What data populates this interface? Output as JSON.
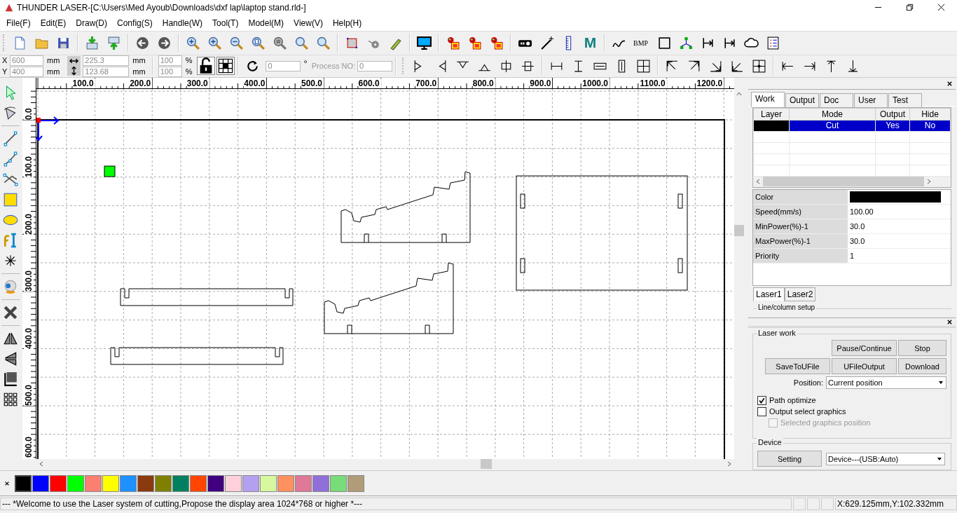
{
  "window": {
    "title": "THUNDER LASER-[C:\\Users\\Med Ayoub\\Downloads\\dxf lap\\laptop stand.rld-]"
  },
  "menu": [
    "File(F)",
    "Edit(E)",
    "Draw(D)",
    "Config(S)",
    "Handle(W)",
    "Tool(T)",
    "Model(M)",
    "View(V)",
    "Help(H)"
  ],
  "toolbar": {
    "labels": [
      "M",
      "BMP"
    ]
  },
  "transform": {
    "disabled": true,
    "position": [
      {
        "label": "X",
        "value": "600",
        "unit": "mm"
      },
      {
        "label": "Y",
        "value": "400",
        "unit": "mm"
      }
    ],
    "size": [
      {
        "value": "225.3",
        "unit": "mm"
      },
      {
        "value": "123.68",
        "unit": "mm"
      }
    ],
    "scale": [
      {
        "value": "100",
        "unit": "%"
      },
      {
        "value": "100",
        "unit": "%"
      }
    ],
    "angle": {
      "value": "0",
      "unit": "°"
    },
    "process": {
      "label": "Process NO:",
      "value": "0"
    }
  },
  "canvas": {
    "x_ruler": [
      "100.0",
      "200.0",
      "300.0",
      "400.0",
      "500.0",
      "600.0",
      "700.0",
      "800.0",
      "900.0",
      "1000.0",
      "1100.0",
      "1200.0"
    ],
    "y_ruler": [
      "0.0",
      "100.0",
      "200.0",
      "300.0",
      "400.0",
      "500.0",
      "600.0"
    ]
  },
  "panel": {
    "tabs": [
      {
        "label": "Work",
        "selected": true
      },
      {
        "label": "Output",
        "selected": false
      },
      {
        "label": "Doc",
        "selected": false
      },
      {
        "label": "User",
        "selected": false
      },
      {
        "label": "Test",
        "selected": false
      }
    ],
    "layer_table": {
      "columns": [
        "Layer",
        "Mode",
        "Output",
        "Hide"
      ],
      "rows": [
        {
          "color": "#000000",
          "mode": "Cut",
          "output": "Yes",
          "hide": "No",
          "selected": true
        }
      ]
    },
    "properties": [
      {
        "label": "Color",
        "kind": "color",
        "color": "#000000"
      },
      {
        "label": "Speed(mm/s)",
        "kind": "text",
        "value": "100.00"
      },
      {
        "label": "MinPower(%)-1",
        "kind": "text",
        "value": "30.0"
      },
      {
        "label": "MaxPower(%)-1",
        "kind": "text",
        "value": "30.0"
      },
      {
        "label": "Priority",
        "kind": "text",
        "value": "1"
      }
    ],
    "laser_tabs": [
      {
        "label": "Laser1",
        "selected": true
      },
      {
        "label": "Laser2",
        "selected": false
      }
    ],
    "section": "Line/column setup"
  },
  "laser_work": {
    "title": "Laser work",
    "buttons": [
      "Pause/Continue",
      "Stop",
      "SaveToUFile",
      "UFileOutput",
      "Download"
    ],
    "position_label": "Position:",
    "position": "Current position",
    "options": [
      {
        "label": "Path optimize",
        "checked": true,
        "disabled": false
      },
      {
        "label": "Output select graphics",
        "checked": false,
        "disabled": false,
        "children": [
          {
            "label": "Selected graphics position",
            "checked": false,
            "disabled": true
          }
        ]
      }
    ]
  },
  "device": {
    "title": "Device",
    "button": "Setting",
    "value": "Device---(USB:Auto)"
  },
  "palette": [
    {
      "color": "#000000",
      "selected": true
    },
    {
      "color": "#0000ff",
      "selected": false
    },
    {
      "color": "#ff0000",
      "selected": false
    },
    {
      "color": "#00ff00",
      "selected": false
    },
    {
      "color": "#fa8072",
      "selected": false
    },
    {
      "color": "#ffff00",
      "selected": false
    },
    {
      "color": "#1e90ff",
      "selected": false
    },
    {
      "color": "#8b3a0f",
      "selected": false
    },
    {
      "color": "#808000",
      "selected": false
    },
    {
      "color": "#008060",
      "selected": false
    },
    {
      "color": "#ff4500",
      "selected": false
    },
    {
      "color": "#400080",
      "selected": false
    },
    {
      "color": "#ffd0dc",
      "selected": false
    },
    {
      "color": "#b4a0f0",
      "selected": false
    },
    {
      "color": "#d8f8a0",
      "selected": false
    },
    {
      "color": "#ff9060",
      "selected": false
    },
    {
      "color": "#e07898",
      "selected": false
    },
    {
      "color": "#9070d8",
      "selected": false
    },
    {
      "color": "#78dc78",
      "selected": false
    },
    {
      "color": "#b09c78",
      "selected": false
    }
  ],
  "status_bar": {
    "message": "--- *Welcome to use the Laser system of cutting,Propose the display area 1024*768 or higher *---",
    "coordinates": "X:629.125mm,Y:102.332mm"
  }
}
